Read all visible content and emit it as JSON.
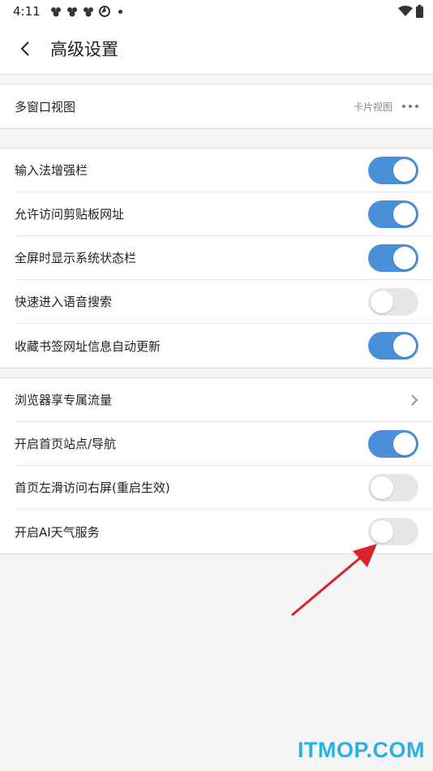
{
  "status_bar": {
    "time": "4:11"
  },
  "header": {
    "title": "高级设置"
  },
  "groups": [
    {
      "items": [
        {
          "label": "多窗口视图",
          "value": "卡片视图",
          "control": "more"
        }
      ]
    },
    {
      "items": [
        {
          "label": "输入法增强栏",
          "control": "toggle",
          "on": true
        },
        {
          "label": "允许访问剪贴板网址",
          "control": "toggle",
          "on": true
        },
        {
          "label": "全屏时显示系统状态栏",
          "control": "toggle",
          "on": true
        },
        {
          "label": "快速进入语音搜索",
          "control": "toggle",
          "on": false
        },
        {
          "label": "收藏书签网址信息自动更新",
          "control": "toggle",
          "on": true
        }
      ]
    },
    {
      "items": [
        {
          "label": "浏览器享专属流量",
          "control": "chevron"
        },
        {
          "label": "开启首页站点/导航",
          "control": "toggle",
          "on": true
        },
        {
          "label": "首页左滑访问右屏(重启生效)",
          "control": "toggle",
          "on": false
        },
        {
          "label": "开启AI天气服务",
          "control": "toggle",
          "on": false
        }
      ]
    }
  ],
  "colors": {
    "toggle_on": "#4a90d9",
    "toggle_off": "#e6e6e6",
    "annotation_arrow": "#d9232a",
    "watermark": "#2ab0e6"
  },
  "watermark": "ITMOP.COM"
}
